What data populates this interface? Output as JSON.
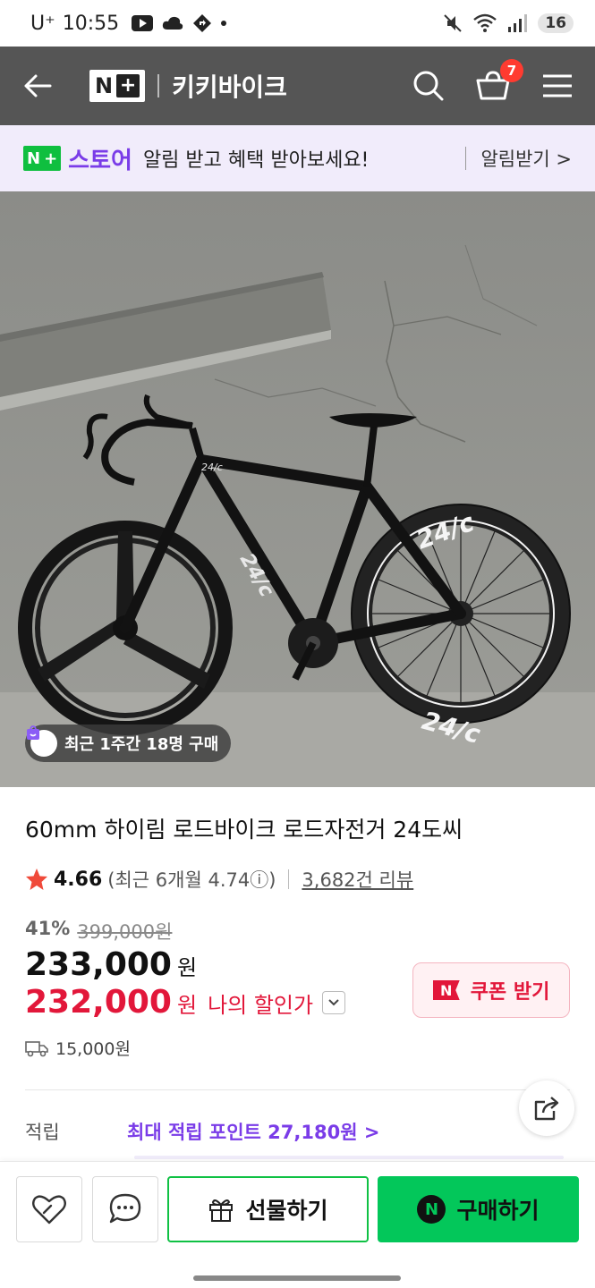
{
  "status_bar": {
    "carrier": "U⁺",
    "time": "10:55",
    "battery": "16"
  },
  "header": {
    "logo": "N+",
    "store_name": "키키바이크",
    "cart_count": "7"
  },
  "banner": {
    "badge": "N+",
    "store_label": "스토어",
    "message": "알림 받고 혜택 받아보세요!",
    "alarm_label": "알림받기 >"
  },
  "hero": {
    "purchase_badge": "최근 1주간 18명 구매",
    "bike_brand": "24/c"
  },
  "product": {
    "title": "60mm 하이림 로드바이크 로드자전거 24도씨",
    "rating": "4.66",
    "recent_rating": "(최근 6개월 4.74ⓘ)",
    "reviews": "3,682건 리뷰",
    "discount_pct": "41%",
    "original_price": "399,000원",
    "price": "233,000",
    "price_unit": "원",
    "my_price": "232,000",
    "my_price_unit": "원",
    "my_price_label": "나의 할인가",
    "coupon_label": "쿠폰 받기",
    "shipping": "15,000원",
    "points_label": "적립",
    "points_value": "최대 적립 포인트 27,180원 >"
  },
  "bottom_bar": {
    "gift_label": "선물하기",
    "buy_label": "구매하기"
  },
  "colors": {
    "header_bg": "#555555",
    "banner_bg": "#f1ecfb",
    "accent_purple": "#7a3ce8",
    "sale_red": "#e2173a",
    "naver_green": "#03c75a",
    "star": "#f04a3a"
  }
}
